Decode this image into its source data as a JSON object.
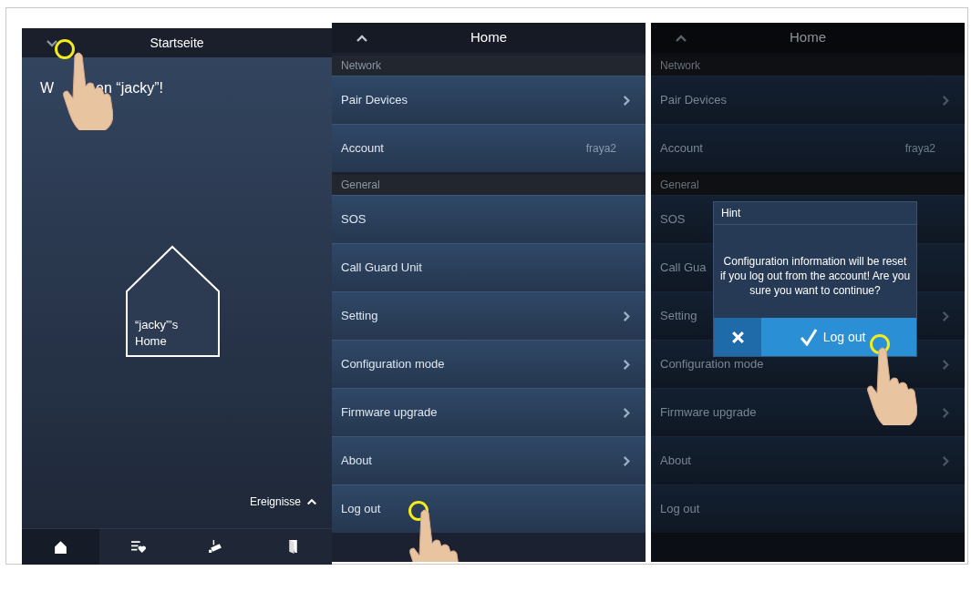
{
  "start_screen": {
    "title": "Startseite",
    "welcome_parts": [
      "W",
      "en “jacky”!"
    ],
    "home_label": "“jacky”'s Home",
    "events_label": "Ereignisse",
    "tab_bar": [
      {
        "kind": "home",
        "selected": true
      },
      {
        "kind": "favorites",
        "selected": false
      },
      {
        "kind": "camera",
        "selected": false
      },
      {
        "kind": "door",
        "selected": false
      }
    ]
  },
  "settings_screen": {
    "title": "Home",
    "items": [
      {
        "kind": "section",
        "label": "Network"
      },
      {
        "kind": "row",
        "label": "Pair Devices",
        "chevron": true
      },
      {
        "kind": "row",
        "label": "Account",
        "value": "fraya2",
        "chevron": false
      },
      {
        "kind": "section",
        "label": "General"
      },
      {
        "kind": "row",
        "label": "SOS",
        "chevron": false
      },
      {
        "kind": "row",
        "label": "Call Guard Unit",
        "chevron": false
      },
      {
        "kind": "row",
        "label": "Setting",
        "chevron": true
      },
      {
        "kind": "row",
        "label": "Configuration mode",
        "chevron": true
      },
      {
        "kind": "row",
        "label": "Firmware upgrade",
        "chevron": true
      },
      {
        "kind": "row",
        "label": "About",
        "chevron": true
      },
      {
        "kind": "row",
        "label": "Log out",
        "chevron": false
      }
    ]
  },
  "dialog_screen": {
    "title": "Home",
    "items": [
      {
        "kind": "section",
        "label": "Network"
      },
      {
        "kind": "row",
        "label": "Pair Devices",
        "chevron": true
      },
      {
        "kind": "row",
        "label": "Account",
        "value": "fraya2",
        "chevron": false
      },
      {
        "kind": "section",
        "label": "General"
      },
      {
        "kind": "row",
        "label": "SOS",
        "chevron": false
      },
      {
        "kind": "row",
        "label": "Call Gua",
        "chevron": false
      },
      {
        "kind": "row",
        "label": "Setting",
        "chevron": true
      },
      {
        "kind": "row",
        "label": "Configuration mode",
        "chevron": true
      },
      {
        "kind": "row",
        "label": "Firmware upgrade",
        "chevron": true
      },
      {
        "kind": "row",
        "label": "About",
        "chevron": true
      },
      {
        "kind": "row",
        "label": "Log out",
        "chevron": false
      }
    ],
    "dialog": {
      "title": "Hint",
      "message": "Configuration information will be reset if you log out from the account! Are you sure you want to continue?",
      "confirm_label": "Log out"
    }
  }
}
